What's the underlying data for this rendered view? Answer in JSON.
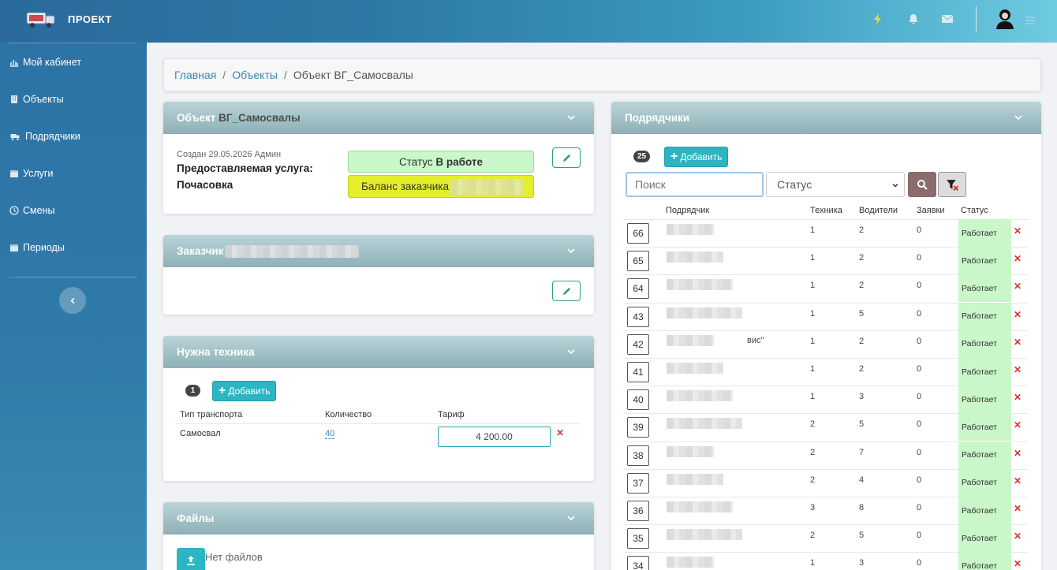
{
  "app": {
    "brand": "ПРОЕКТ"
  },
  "sidebar": {
    "items": [
      {
        "label": "Мой кабинет",
        "icon": "chart-icon"
      },
      {
        "label": "Объекты",
        "icon": "building-icon"
      },
      {
        "label": "Подрядчики",
        "icon": "truck-icon"
      },
      {
        "label": "Услуги",
        "icon": "calendar-icon"
      },
      {
        "label": "Смены",
        "icon": "clock-icon"
      },
      {
        "label": "Периоды",
        "icon": "calendar-icon"
      }
    ]
  },
  "breadcrumb": {
    "home": "Главная",
    "objects": "Объекты",
    "current": "Объект ВГ_Самосвалы"
  },
  "object_card": {
    "title_prefix": "Объект",
    "title_name": "ВГ_Самосвалы",
    "created": "Создан 29.05.2026 Админ",
    "service_label": "Предоставляемая услуга:",
    "service_value": "Почасовка",
    "status_label": "Статус",
    "status_value": "В работе",
    "balance_label": "Баланс заказчика"
  },
  "customer_card": {
    "title": "Заказчик"
  },
  "tech_card": {
    "title": "Нужна техника",
    "count": "1",
    "add_label": "Добавить",
    "headers": {
      "type": "Тип транспорта",
      "qty": "Количество",
      "tariff": "Тариф"
    },
    "row": {
      "type": "Самосвал",
      "qty": "40",
      "tariff": "4 200.00"
    }
  },
  "files_card": {
    "title": "Файлы",
    "empty": "Нет файлов"
  },
  "contractors_card": {
    "title": "Подрядчики",
    "count": "25",
    "add_label": "Добавить",
    "search_placeholder": "Поиск",
    "status_select": "Статус",
    "headers": {
      "contractor": "Подрядчик",
      "tech": "Техника",
      "drivers": "Водители",
      "requests": "Заявки",
      "status": "Статус"
    },
    "rows": [
      {
        "id": "66",
        "name_suffix": "",
        "tech": "1",
        "drivers": "2",
        "requests": "0",
        "status": "Работает"
      },
      {
        "id": "65",
        "name_suffix": "",
        "tech": "1",
        "drivers": "2",
        "requests": "0",
        "status": "Работает"
      },
      {
        "id": "64",
        "name_suffix": "",
        "tech": "1",
        "drivers": "2",
        "requests": "0",
        "status": "Работает"
      },
      {
        "id": "43",
        "name_suffix": "",
        "tech": "1",
        "drivers": "5",
        "requests": "0",
        "status": "Работает"
      },
      {
        "id": "42",
        "name_suffix": "вис\"",
        "tech": "1",
        "drivers": "2",
        "requests": "0",
        "status": "Работает"
      },
      {
        "id": "41",
        "name_suffix": "",
        "tech": "1",
        "drivers": "2",
        "requests": "0",
        "status": "Работает"
      },
      {
        "id": "40",
        "name_suffix": "",
        "tech": "1",
        "drivers": "3",
        "requests": "0",
        "status": "Работает"
      },
      {
        "id": "39",
        "name_suffix": "",
        "tech": "2",
        "drivers": "5",
        "requests": "0",
        "status": "Работает"
      },
      {
        "id": "38",
        "name_suffix": "",
        "tech": "2",
        "drivers": "7",
        "requests": "0",
        "status": "Работает"
      },
      {
        "id": "37",
        "name_suffix": "",
        "tech": "2",
        "drivers": "4",
        "requests": "0",
        "status": "Работает"
      },
      {
        "id": "36",
        "name_suffix": "",
        "tech": "3",
        "drivers": "8",
        "requests": "0",
        "status": "Работает"
      },
      {
        "id": "35",
        "name_suffix": "",
        "tech": "2",
        "drivers": "5",
        "requests": "0",
        "status": "Работает"
      },
      {
        "id": "34",
        "name_suffix": "",
        "tech": "1",
        "drivers": "3",
        "requests": "0",
        "status": "Работает"
      }
    ]
  },
  "colors": {
    "status_green": "#c9f7c9",
    "balance_yellow": "#e4ee2a",
    "accent": "#2cb5c3"
  }
}
